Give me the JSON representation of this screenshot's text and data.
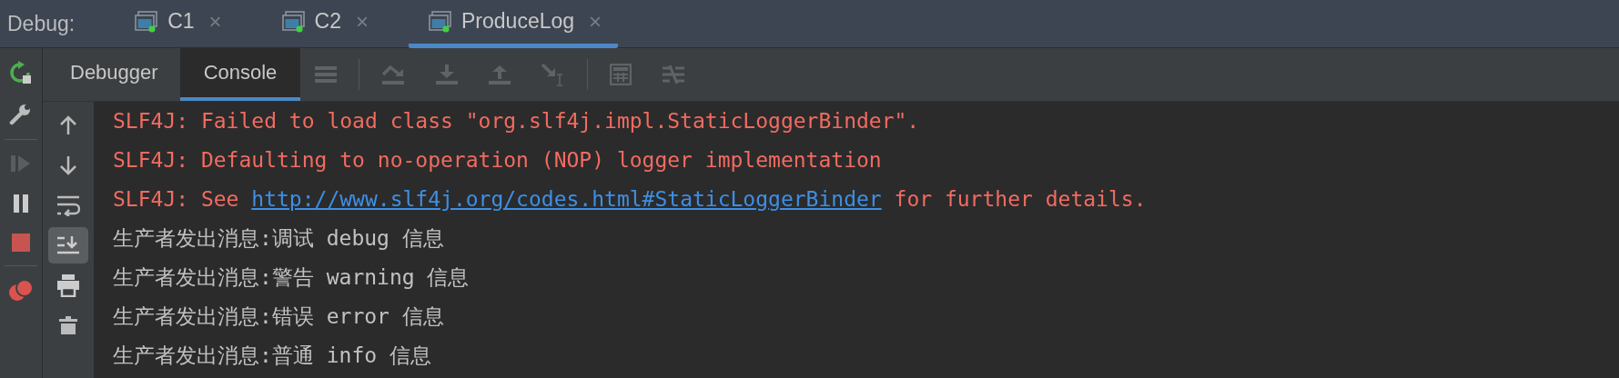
{
  "debug_bar": {
    "label": "Debug:",
    "tabs": [
      {
        "label": "C1",
        "selected": false,
        "close": "×"
      },
      {
        "label": "C2",
        "selected": false,
        "close": "×"
      },
      {
        "label": "ProduceLog",
        "selected": true,
        "close": "×"
      }
    ]
  },
  "sub_tabs": [
    {
      "label": "Debugger",
      "selected": false
    },
    {
      "label": "Console",
      "selected": true
    }
  ],
  "console_tools": [
    {
      "kind": "up",
      "toggled": false
    },
    {
      "kind": "down",
      "toggled": false
    },
    {
      "kind": "wrap",
      "toggled": false
    },
    {
      "kind": "scroll",
      "toggled": true
    },
    {
      "kind": "print",
      "toggled": false
    },
    {
      "kind": "trash",
      "toggled": false
    }
  ],
  "console_lines": [
    {
      "kind": "error",
      "segments": [
        {
          "text": "SLF4J: Failed to load class \"org.slf4j.impl.StaticLoggerBinder\".",
          "link": false
        }
      ]
    },
    {
      "kind": "error",
      "segments": [
        {
          "text": "SLF4J: Defaulting to no-operation (NOP) logger implementation",
          "link": false
        }
      ]
    },
    {
      "kind": "error",
      "segments": [
        {
          "text": "SLF4J: See ",
          "link": false
        },
        {
          "text": "http://www.slf4j.org/codes.html#StaticLoggerBinder",
          "link": true
        },
        {
          "text": " for further details.",
          "link": false
        }
      ]
    },
    {
      "kind": "output",
      "segments": [
        {
          "text": "生产者发出消息:调试 debug 信息",
          "link": false
        }
      ]
    },
    {
      "kind": "output",
      "segments": [
        {
          "text": "生产者发出消息:警告 warning 信息",
          "link": false
        }
      ]
    },
    {
      "kind": "output",
      "segments": [
        {
          "text": "生产者发出消息:错误 error 信息",
          "link": false
        }
      ]
    },
    {
      "kind": "output",
      "segments": [
        {
          "text": "生产者发出消息:普通 info 信息",
          "link": false
        }
      ]
    }
  ]
}
